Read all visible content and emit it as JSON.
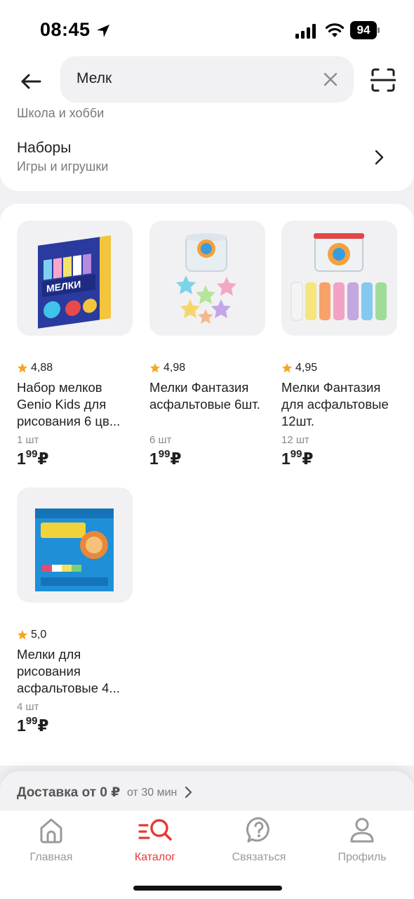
{
  "status_bar": {
    "time": "08:45",
    "battery": "94"
  },
  "search": {
    "query": "Мелк"
  },
  "category": {
    "previous_partial": "Школа и хобби",
    "title": "Наборы",
    "subtitle": "Игры и игрушки"
  },
  "products": [
    {
      "rating": "4,88",
      "name": "Набор мелков Genio Kids для рисования 6 цв...",
      "qty": "1 шт",
      "price_main": "1",
      "price_cents": "99",
      "currency": "₽"
    },
    {
      "rating": "4,98",
      "name": "Мелки Фантазия асфальтовые 6шт.",
      "qty": "6 шт",
      "price_main": "1",
      "price_cents": "99",
      "currency": "₽"
    },
    {
      "rating": "4,95",
      "name": "Мелки Фантазия для асфальтовые 12шт.",
      "qty": "12 шт",
      "price_main": "1",
      "price_cents": "99",
      "currency": "₽"
    },
    {
      "rating": "5,0",
      "name": "Мелки для рисования асфальтовые 4...",
      "qty": "4 шт",
      "price_main": "1",
      "price_cents": "99",
      "currency": "₽"
    }
  ],
  "delivery": {
    "main": "Доставка от 0 ₽",
    "sub": "от 30 мин"
  },
  "tabs": [
    {
      "label": "Главная",
      "icon": "home-icon"
    },
    {
      "label": "Каталог",
      "icon": "catalog-search-icon"
    },
    {
      "label": "Связаться",
      "icon": "help-icon"
    },
    {
      "label": "Профиль",
      "icon": "profile-icon"
    }
  ],
  "colors": {
    "accent": "#e53935",
    "star": "#f5a623",
    "inactive_tab": "#9a9a9a"
  }
}
